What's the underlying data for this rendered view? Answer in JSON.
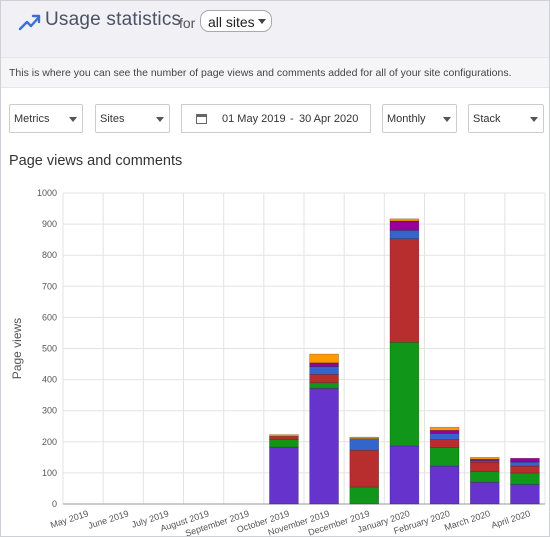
{
  "header": {
    "title": "Usage statistics",
    "for_label": "for",
    "site_select": "all sites"
  },
  "info_text": "This is where you can see the number of page views and comments added for all of your site configurations.",
  "filters": {
    "metrics": "Metrics",
    "sites": "Sites",
    "date_from": "01 May 2019",
    "date_sep": "-",
    "date_to": "30 Apr 2020",
    "period": "Monthly",
    "mode": "Stack"
  },
  "section_title": "Page views and comments",
  "chart_data": {
    "type": "bar",
    "stacked": true,
    "ylabel": "Page views",
    "ylim": [
      0,
      1000
    ],
    "yticks": [
      0,
      100,
      200,
      300,
      400,
      500,
      600,
      700,
      800,
      900,
      1000
    ],
    "grid": true,
    "categories": [
      "May 2019",
      "June 2019",
      "July 2019",
      "August 2019",
      "September 2019",
      "October 2019",
      "November 2019",
      "December 2019",
      "January 2020",
      "February 2020",
      "March 2020",
      "April 2020"
    ],
    "series": [
      {
        "color": "#6633cc",
        "values": [
          0,
          0,
          0,
          0,
          0,
          183,
          372,
          0,
          187,
          122,
          70,
          63
        ]
      },
      {
        "color": "#109618",
        "values": [
          0,
          0,
          0,
          0,
          0,
          25,
          18,
          55,
          333,
          60,
          35,
          37
        ]
      },
      {
        "color": "#b82e2e",
        "values": [
          0,
          0,
          0,
          0,
          0,
          10,
          27,
          118,
          333,
          25,
          30,
          22
        ]
      },
      {
        "color": "#3366cc",
        "values": [
          0,
          0,
          0,
          0,
          0,
          0,
          25,
          37,
          27,
          20,
          5,
          13
        ]
      },
      {
        "color": "#990099",
        "values": [
          0,
          0,
          0,
          0,
          0,
          0,
          12,
          0,
          30,
          10,
          4,
          12
        ]
      },
      {
        "color": "#ff9900",
        "values": [
          0,
          0,
          0,
          0,
          0,
          5,
          28,
          5,
          7,
          10,
          6,
          0
        ]
      }
    ]
  }
}
